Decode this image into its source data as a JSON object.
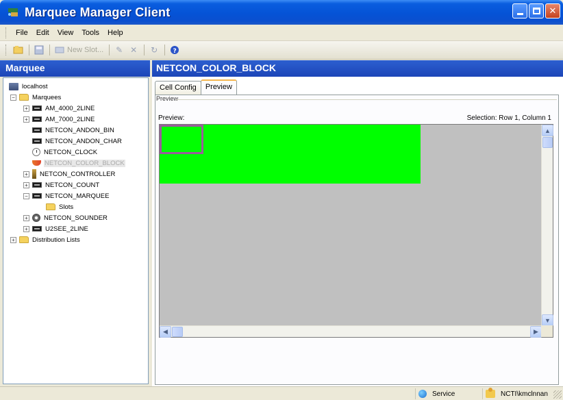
{
  "window": {
    "title": "Marquee Manager Client"
  },
  "menu": [
    "File",
    "Edit",
    "View",
    "Tools",
    "Help"
  ],
  "toolbar": {
    "new_slot_label": "New Slot..."
  },
  "left_panel": {
    "header": "Marquee",
    "tree": [
      {
        "label": "localhost",
        "icon": "server-icon",
        "level": 0,
        "expander": ""
      },
      {
        "label": "Marquees",
        "icon": "folder-icon",
        "level": 1,
        "expander": "-"
      },
      {
        "label": "AM_4000_2LINE",
        "icon": "sign-icon",
        "level": 2,
        "expander": "+"
      },
      {
        "label": "AM_7000_2LINE",
        "icon": "sign-icon",
        "level": 2,
        "expander": "+"
      },
      {
        "label": "NETCON_ANDON_BIN",
        "icon": "sign-icon",
        "level": 2,
        "expander": ""
      },
      {
        "label": "NETCON_ANDON_CHAR",
        "icon": "sign-icon",
        "level": 2,
        "expander": ""
      },
      {
        "label": "NETCON_CLOCK",
        "icon": "clock-icon",
        "level": 2,
        "expander": ""
      },
      {
        "label": "NETCON_COLOR_BLOCK",
        "icon": "color-block-icon",
        "level": 2,
        "expander": "",
        "selected": true
      },
      {
        "label": "NETCON_CONTROLLER",
        "icon": "controller-icon",
        "level": 2,
        "expander": "+"
      },
      {
        "label": "NETCON_COUNT",
        "icon": "sign-icon",
        "level": 2,
        "expander": "+"
      },
      {
        "label": "NETCON_MARQUEE",
        "icon": "sign-icon",
        "level": 2,
        "expander": "-"
      },
      {
        "label": "Slots",
        "icon": "folder-icon",
        "level": 3,
        "expander": ""
      },
      {
        "label": "NETCON_SOUNDER",
        "icon": "sounder-icon",
        "level": 2,
        "expander": "+"
      },
      {
        "label": "U2SEE_2LINE",
        "icon": "sign-icon",
        "level": 2,
        "expander": "+"
      },
      {
        "label": "Distribution Lists",
        "icon": "folder-icon",
        "level": 1,
        "expander": "+"
      }
    ]
  },
  "right_panel": {
    "header": "NETCON_COLOR_BLOCK",
    "tabs": [
      "Cell Config",
      "Preview"
    ],
    "active_tab": "Preview",
    "group_title": "Preview",
    "preview_label": "Preview:",
    "selection_label": "Selection: Row 1, Column 1"
  },
  "colors": {
    "block_fill": "#00ff00",
    "background_fill": "#c0c0c0",
    "selection_border": "#9b5c9c"
  },
  "statusbar": {
    "service": "Service",
    "user": "NCTI\\kmclnnan"
  }
}
